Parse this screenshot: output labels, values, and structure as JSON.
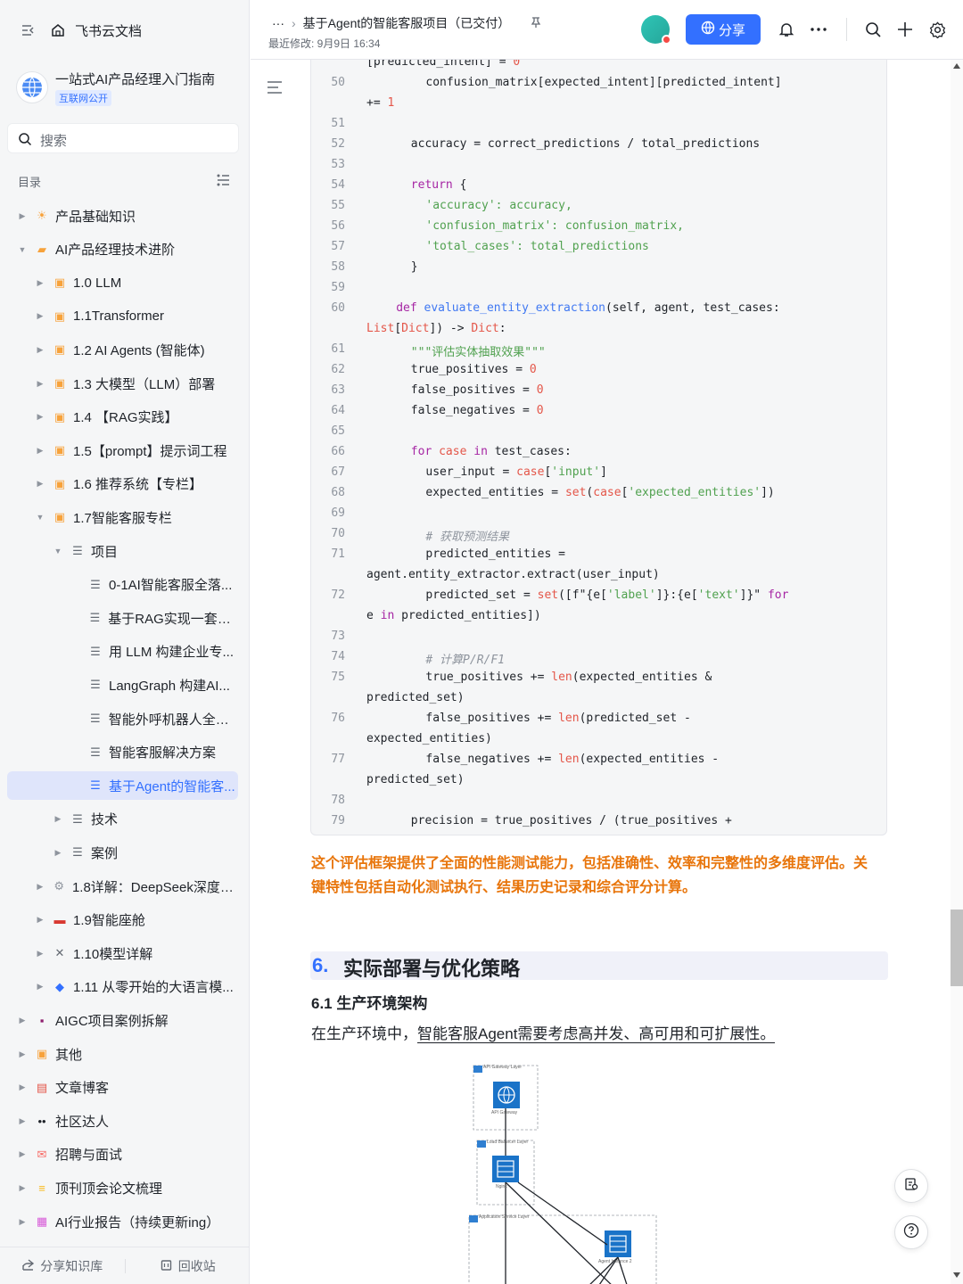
{
  "sidebar": {
    "brand": "飞书云文档",
    "kb_title": "一站式AI产品经理入门指南",
    "kb_badge": "互联网公开",
    "search_placeholder": "搜索",
    "toc_label": "目录",
    "items": [
      {
        "label": "产品基础知识",
        "icon": "sun-icon",
        "color": "#f7a23b"
      },
      {
        "label": "AI产品经理技术进阶",
        "icon": "folder-icon",
        "color": "#f7a23b"
      },
      {
        "label": "1.0 LLM",
        "icon": "doc-icon",
        "color": "#f7a23b"
      },
      {
        "label": "1.1Transformer",
        "icon": "doc-icon",
        "color": "#f7a23b"
      },
      {
        "label": "1.2 AI Agents (智能体)",
        "icon": "doc-icon",
        "color": "#f7a23b"
      },
      {
        "label": "1.3 大模型（LLM）部署",
        "icon": "doc-icon",
        "color": "#f7a23b"
      },
      {
        "label": "1.4 【RAG实践】",
        "icon": "doc-icon",
        "color": "#f7a23b"
      },
      {
        "label": "1.5【prompt】提示词工程",
        "icon": "doc-icon",
        "color": "#f7a23b"
      },
      {
        "label": "1.6 推荐系统【专栏】",
        "icon": "doc-icon",
        "color": "#f7a23b"
      },
      {
        "label": "1.7智能客服专栏",
        "icon": "doc-icon",
        "color": "#f7a23b"
      },
      {
        "label": "项目",
        "icon": "page-icon",
        "color": "#646a73"
      },
      {
        "label": "0-1AI智能客服全落...",
        "icon": "page-icon",
        "color": "#646a73"
      },
      {
        "label": "基于RAG实现一套企...",
        "icon": "page-icon",
        "color": "#646a73"
      },
      {
        "label": "用 LLM 构建企业专...",
        "icon": "page-icon",
        "color": "#646a73"
      },
      {
        "label": "LangGraph 构建AI...",
        "icon": "page-icon",
        "color": "#646a73"
      },
      {
        "label": "智能外呼机器人全链...",
        "icon": "page-icon",
        "color": "#646a73"
      },
      {
        "label": "智能客服解决方案",
        "icon": "page-icon",
        "color": "#646a73"
      },
      {
        "label": "基于Agent的智能客...",
        "icon": "page-icon",
        "color": "#3370ff"
      },
      {
        "label": "技术",
        "icon": "page-icon",
        "color": "#646a73"
      },
      {
        "label": "案例",
        "icon": "page-icon",
        "color": "#646a73"
      },
      {
        "label": "1.8详解：DeepSeek深度推...",
        "icon": "gear-icon",
        "color": "#8f959e"
      },
      {
        "label": "1.9智能座舱",
        "icon": "car-icon",
        "color": "#d83931"
      },
      {
        "label": "1.10模型详解",
        "icon": "tools-icon",
        "color": "#646a73"
      },
      {
        "label": "1.11 从零开始的大语言模...",
        "icon": "stack-icon",
        "color": "#3370ff"
      },
      {
        "label": "AIGC项目案例拆解",
        "icon": "save-icon",
        "color": "#8f1e6e"
      },
      {
        "label": "其他",
        "icon": "doc-icon",
        "color": "#f7a23b"
      },
      {
        "label": "文章博客",
        "icon": "blog-icon",
        "color": "#e45649"
      },
      {
        "label": "社区达人",
        "icon": "eyes-icon",
        "color": "#1f2329"
      },
      {
        "label": "招聘与面试",
        "icon": "mail-icon",
        "color": "#f76964"
      },
      {
        "label": "顶刊顶会论文梳理",
        "icon": "scroll-icon",
        "color": "#f7ba1e"
      },
      {
        "label": "AI行业报告（持续更新ing）",
        "icon": "grid-icon",
        "color": "#d75bd8"
      }
    ],
    "share_label": "分享知识库",
    "trash_label": "回收站"
  },
  "header": {
    "ellipsis": "···",
    "breadcrumb_title": "基于Agent的智能客服项目（已交付）",
    "modified": "最近修改: 9月9日 16:34",
    "share_label": "分享"
  },
  "code": {
    "lines": [
      {
        "n": "",
        "t": "[predicted_intent] = 0"
      },
      {
        "n": "50",
        "t": "confusion_matrix[expected_intent][predicted_intent]"
      },
      {
        "n": "",
        "t": "+= 1"
      },
      {
        "n": "51",
        "t": ""
      },
      {
        "n": "52",
        "t": "accuracy = correct_predictions / total_predictions"
      },
      {
        "n": "53",
        "t": ""
      },
      {
        "n": "54",
        "t": "return {"
      },
      {
        "n": "55",
        "t": "'accuracy': accuracy,"
      },
      {
        "n": "56",
        "t": "'confusion_matrix': confusion_matrix,"
      },
      {
        "n": "57",
        "t": "'total_cases': total_predictions"
      },
      {
        "n": "58",
        "t": "}"
      },
      {
        "n": "59",
        "t": ""
      },
      {
        "n": "60",
        "t": "def evaluate_entity_extraction(self, agent, test_cases:"
      },
      {
        "n": "",
        "t": "List[Dict]) -> Dict:"
      },
      {
        "n": "61",
        "t": "\"\"\"评估实体抽取效果\"\"\""
      },
      {
        "n": "62",
        "t": "true_positives = 0"
      },
      {
        "n": "63",
        "t": "false_positives = 0"
      },
      {
        "n": "64",
        "t": "false_negatives = 0"
      },
      {
        "n": "65",
        "t": ""
      },
      {
        "n": "66",
        "t": "for case in test_cases:"
      },
      {
        "n": "67",
        "t": "user_input = case['input']"
      },
      {
        "n": "68",
        "t": "expected_entities = set(case['expected_entities'])"
      },
      {
        "n": "69",
        "t": ""
      },
      {
        "n": "70",
        "t": "# 获取预测结果"
      },
      {
        "n": "71",
        "t": "predicted_entities ="
      },
      {
        "n": "",
        "t": "agent.entity_extractor.extract(user_input)"
      },
      {
        "n": "72",
        "t": "predicted_set = set([f\"{e['label']}:{e['text']}\" for"
      },
      {
        "n": "",
        "t": "e in predicted_entities])"
      },
      {
        "n": "73",
        "t": ""
      },
      {
        "n": "74",
        "t": "# 计算P/R/F1"
      },
      {
        "n": "75",
        "t": "true_positives += len(expected_entities &"
      },
      {
        "n": "",
        "t": "predicted_set)"
      },
      {
        "n": "76",
        "t": "false_positives += len(predicted_set -"
      },
      {
        "n": "",
        "t": "expected_entities)"
      },
      {
        "n": "77",
        "t": "false_negatives += len(expected_entities -"
      },
      {
        "n": "",
        "t": "predicted_set)"
      },
      {
        "n": "78",
        "t": ""
      },
      {
        "n": "79",
        "t": "precision = true_positives / (true_positives +"
      }
    ]
  },
  "content": {
    "highlight_text": "这个评估框架提供了全面的性能测试能力，包括准确性、效率和完整性的多维度评估。关键特性包括自动化测试执行、结果历史记录和综合评分计算。",
    "section_number": "6.",
    "section_title": "实际部署与优化策略",
    "subsection_title": "6.1 生产环境架构",
    "paragraph_prefix": "在生产环境中，",
    "paragraph_underlined": "智能客服Agent需要考虑高并发、高可用和可扩展性。",
    "diagram_labels": {
      "api_layer": "API Gateway Layer",
      "api_node": "API Gateway",
      "lb_layer": "Load Balancer Layer",
      "lb_node": "Nginx",
      "app_layer": "Application Service Layer",
      "app_node": "Agent Instance 2"
    }
  },
  "colors": {
    "accent": "#3370ff",
    "highlight": "#e8750b",
    "active_bg": "#dfe5fb"
  }
}
